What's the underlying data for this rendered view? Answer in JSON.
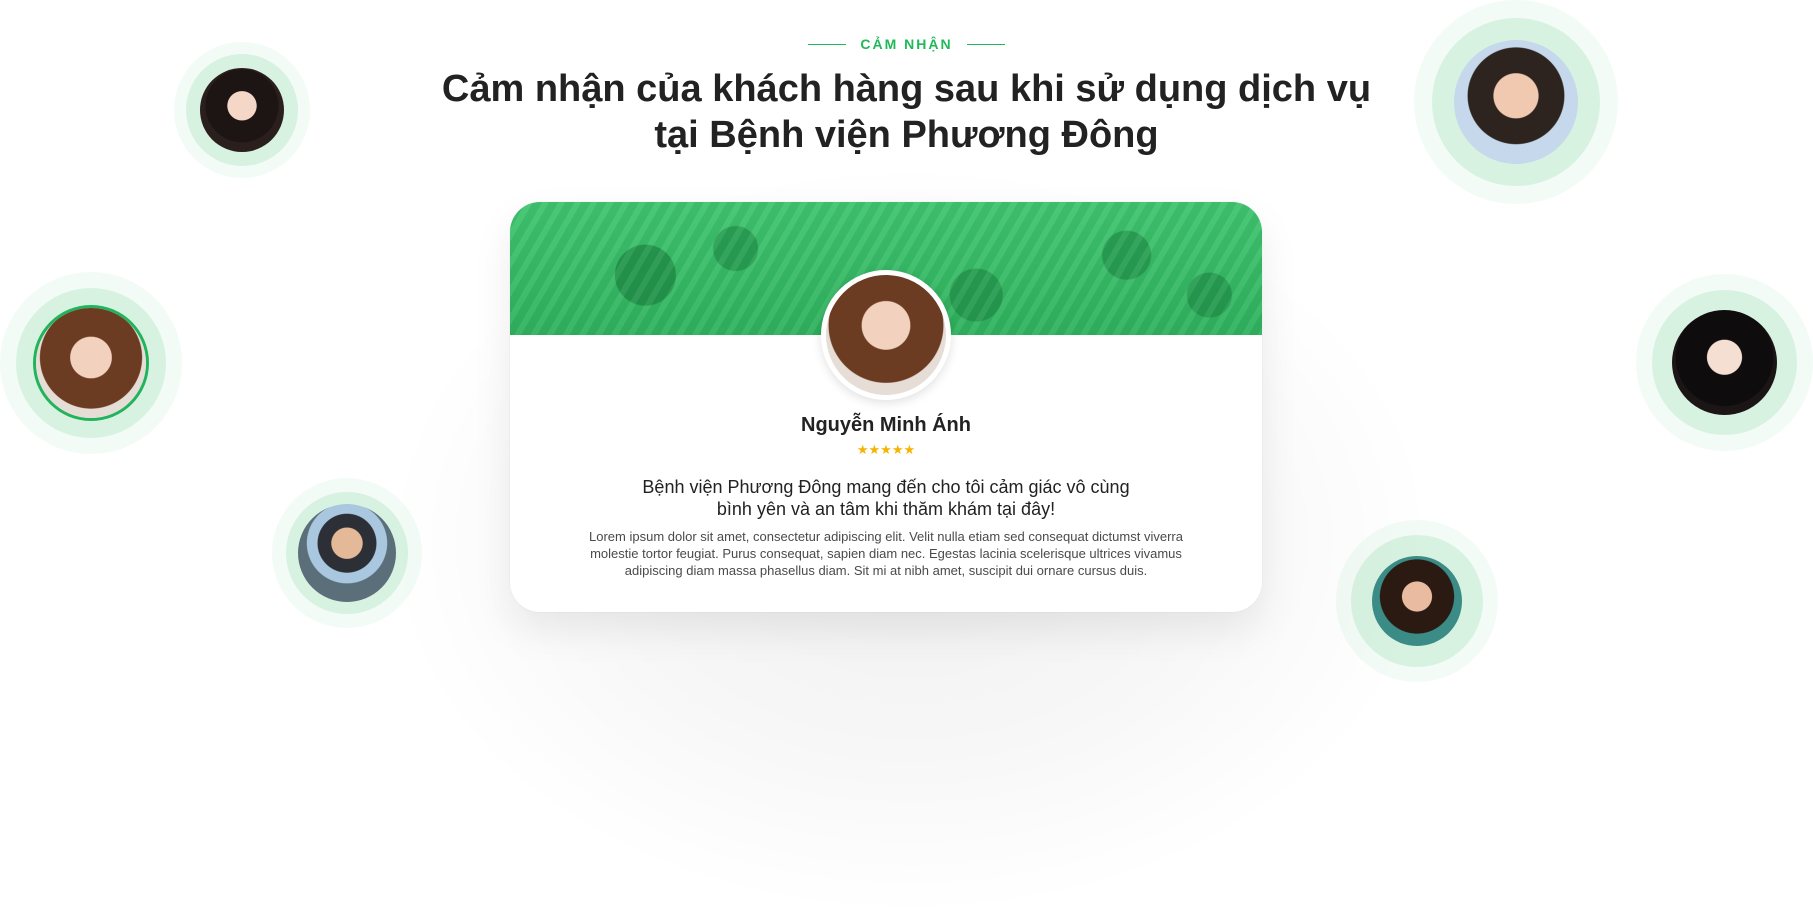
{
  "section": {
    "eyebrow": "CẢM NHẬN",
    "title_line1": "Cảm nhận của khách hàng sau khi sử dụng dịch vụ",
    "title_line2": "tại Bệnh viện Phương Đông"
  },
  "testimonial": {
    "name": "Nguyễn Minh Ánh",
    "rating": 5,
    "stars": "★★★★★",
    "headline_line1": "Bệnh viện Phương Đông mang đến cho tôi cảm giác vô cùng",
    "headline_line2": "bình yên và an tâm khi thăm khám tại đây!",
    "body": "Lorem ipsum dolor sit amet, consectetur adipiscing elit. Velit nulla etiam sed consequat dictumst viverra molestie tortor feugiat. Purus consequat, sapien diam nec. Egestas lacinia scelerisque ultrices vivamus adipiscing diam massa phasellus diam. Sit mi at nibh amet, suscipit dui ornare cursus duis."
  },
  "colors": {
    "accent": "#20b858",
    "star": "#f4b400",
    "banner": "#3fc46f"
  },
  "avatars": {
    "selected_index": 1
  }
}
